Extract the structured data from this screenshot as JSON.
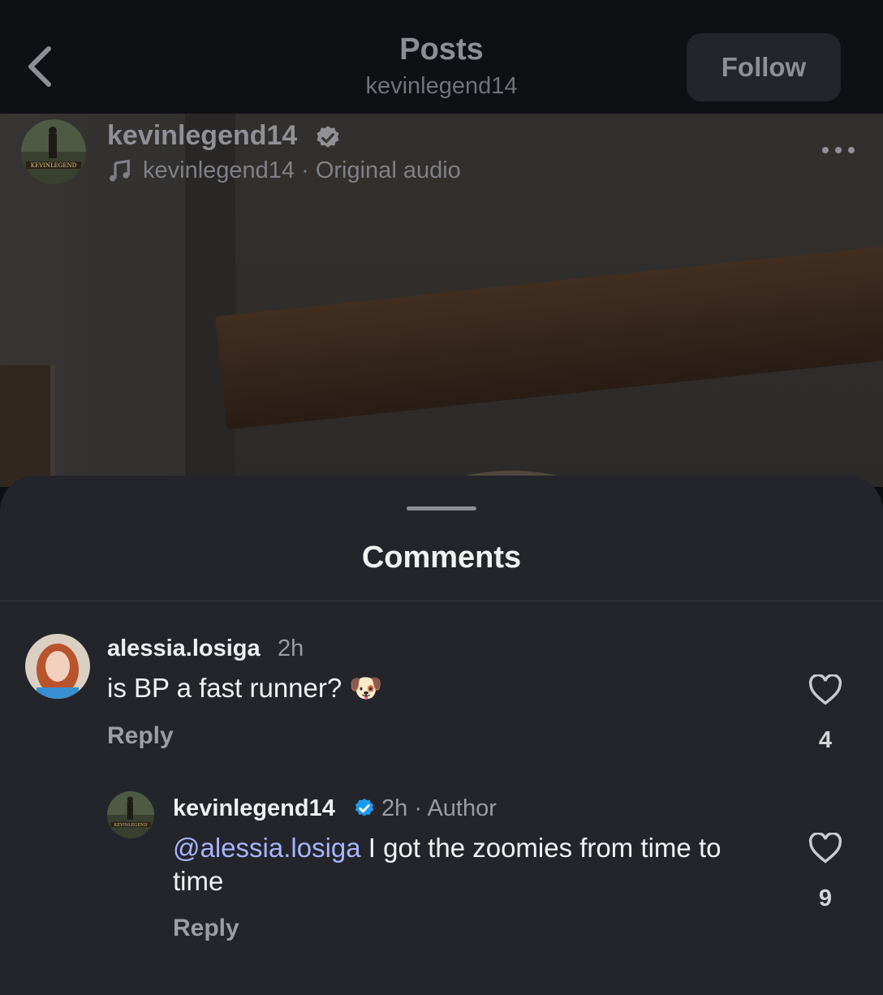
{
  "top_bar": {
    "title": "Posts",
    "subtitle": "kevinlegend14",
    "follow_label": "Follow"
  },
  "post": {
    "username": "kevinlegend14",
    "audio_owner": "kevinlegend14",
    "audio_separator": " · ",
    "audio_label": "Original audio",
    "avatar_lettering": "KEVINLEGEND"
  },
  "comments_sheet": {
    "title": "Comments",
    "comments": [
      {
        "username": "alessia.losiga",
        "time": "2h",
        "text": "is BP a fast runner?",
        "emoji": "🐶",
        "reply_label": "Reply",
        "likes": "4"
      },
      {
        "username": "kevinlegend14",
        "time": "2h",
        "author_tag": "· Author",
        "mention": "@alessia.losiga",
        "text": "I got the zoomies from time to time",
        "reply_label": "Reply",
        "likes": "9"
      }
    ]
  },
  "colors": {
    "sheet_background": "#23252b",
    "verified_blue": "#1d9bf0",
    "mention": "#a9b4ff"
  }
}
